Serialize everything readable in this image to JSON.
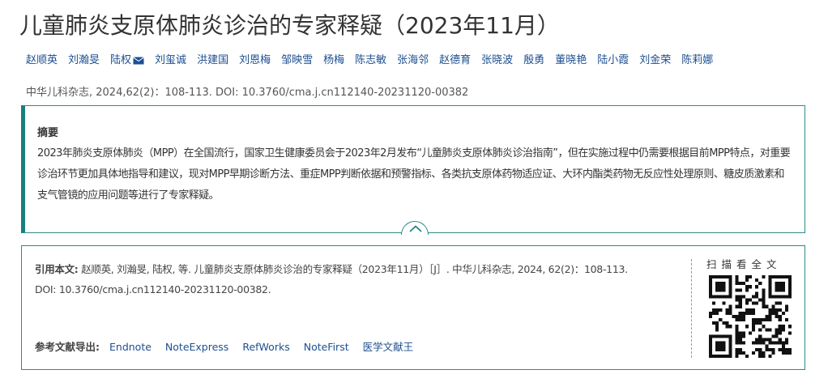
{
  "article": {
    "title": "儿童肺炎支原体肺炎诊治的专家释疑（2023年11月）",
    "authors": [
      {
        "name": "赵顺英"
      },
      {
        "name": "刘瀚旻"
      },
      {
        "name": "陆权",
        "mail": true
      },
      {
        "name": "刘玺诚"
      },
      {
        "name": "洪建国"
      },
      {
        "name": "刘恩梅"
      },
      {
        "name": "邹映雪"
      },
      {
        "name": "杨梅"
      },
      {
        "name": "陈志敏"
      },
      {
        "name": "张海邻"
      },
      {
        "name": "赵德育"
      },
      {
        "name": "张晓波"
      },
      {
        "name": "殷勇"
      },
      {
        "name": "董晓艳"
      },
      {
        "name": "陆小霞"
      },
      {
        "name": "刘金荣"
      },
      {
        "name": "陈莉娜"
      }
    ],
    "journal_line": "中华儿科杂志, 2024,62(2)：108-113. DOI: 10.3760/cma.j.cn112140-20231120-00382"
  },
  "abstract": {
    "label": "摘要",
    "text": "2023年肺炎支原体肺炎（MPP）在全国流行，国家卫生健康委员会于2023年2月发布“儿童肺炎支原体肺炎诊治指南”，但在实施过程中仍需要根据目前MPP特点，对重要诊治环节更加具体地指导和建议，现对MPP早期诊断方法、重症MPP判断依据和预警指标、各类抗支原体药物适应证、大环内酯类药物无反应性处理原则、糖皮质激素和支气管镜的应用问题等进行了专家释疑。"
  },
  "citation": {
    "label": "引用本文:",
    "text": "赵顺英, 刘瀚旻, 陆权, 等. 儿童肺炎支原体肺炎诊治的专家释疑（2023年11月）［J］. 中华儿科杂志, 2024, 62(2)：108-113. DOI: 10.3760/cma.j.cn112140-20231120-00382.",
    "export_label": "参考文献导出:",
    "export_links": [
      "Endnote",
      "NoteExpress",
      "RefWorks",
      "NoteFirst",
      "医学文献王"
    ]
  },
  "qr": {
    "label": "扫描看全文",
    "icon": "qr-code-icon"
  },
  "colors": {
    "link": "#1d4f91",
    "accent": "#1a7e7e",
    "border": "#2e8b8b"
  },
  "icons": {
    "mail": "mail-icon",
    "toggle": "chevron-up-icon"
  }
}
